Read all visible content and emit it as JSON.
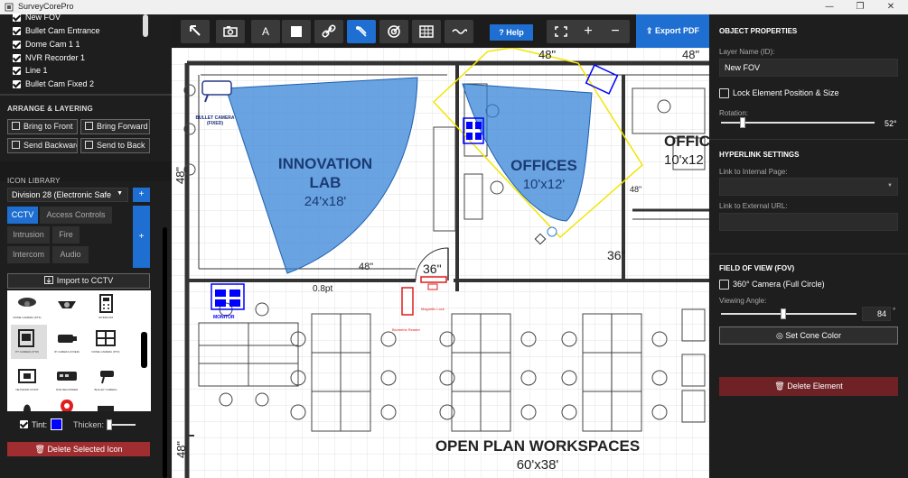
{
  "window": {
    "title": "SurveyCorePro",
    "minimize": "—",
    "maximize": "❐",
    "close": "✕"
  },
  "layers": {
    "items": [
      {
        "label": "New FOV",
        "checked": true
      },
      {
        "label": "Bullet Cam Entrance",
        "checked": true
      },
      {
        "label": "Dome Cam 1 1",
        "checked": true
      },
      {
        "label": "NVR Recorder  1",
        "checked": true
      },
      {
        "label": "Line 1",
        "checked": true
      },
      {
        "label": "Bullet Cam Fixed  2",
        "checked": true
      }
    ]
  },
  "arrange": {
    "title": "ARRANGE & LAYERING",
    "bring_front": "Bring to Front",
    "bring_forward": "Bring Forward",
    "send_backward": "Send Backward",
    "send_back": "Send to Back"
  },
  "icon_library": {
    "title": "ICON LIBRARY",
    "division": "Division 28 (Electronic Safe",
    "add_division": "+",
    "categories": [
      "CCTV",
      "Access Controls",
      "Intrusion",
      "Fire",
      "Intercom",
      "Audio"
    ],
    "active_category": "CCTV",
    "add_category": "+",
    "import_button": "Import to CCTV",
    "icon_names": [
      "DOME CAMERA (PTZ)",
      "",
      "INTERCOM",
      "PT CAMERA (PTZ)",
      "IP CAMERA (FIXED)",
      "DOME CAMERA (PTZ)",
      "NETWORK POINT",
      "NVR RECORDER",
      "BULLET CAMERA"
    ],
    "tint_label": "Tint:",
    "tint_color": "#0000ff",
    "thicken_label": "Thicken:",
    "delete_icon": "Delete Selected Icon"
  },
  "toolbar": {
    "text_tool": "A",
    "help": "Help",
    "export": "Export PDF",
    "zoom_in": "+",
    "zoom_out": "−",
    "active_tool": "camera-fov"
  },
  "floorplan": {
    "dims": [
      "48\"",
      "48\"",
      "48\"",
      "48\"",
      "36\"",
      "36\"",
      "48\"",
      "48\""
    ],
    "rooms": [
      {
        "name": "INNOVATION",
        "name2": "LAB",
        "size": "24'x18'"
      },
      {
        "name": "OFFICES",
        "size": "10'x12'"
      },
      {
        "name": "OFFIC",
        "size": "10'x12"
      },
      {
        "name": "OPEN PLAN WORKSPACES",
        "size": "60'x38'"
      }
    ],
    "line_label": "0.8pt",
    "device_labels": {
      "bullet_camera": "BULLET CAMERA",
      "bullet_camera_sub": "(FIXED)",
      "monitor": "MONITOR",
      "magnetic_lock": "Magnetic Lock",
      "biometric_reader": "Biometric Reader"
    },
    "fov_color": "#2f7fd6",
    "selection_color": "#f2e600"
  },
  "properties": {
    "title": "OBJECT PROPERTIES",
    "layer_name_label": "Layer Name (ID):",
    "layer_name_value": "New FOV",
    "lock_label": "Lock Element Position & Size",
    "lock_checked": false,
    "rotation_label": "Rotation:",
    "rotation_value": "52°",
    "rotation_fraction": 0.14
  },
  "hyperlink": {
    "title": "HYPERLINK SETTINGS",
    "internal_label": "Link to Internal Page:",
    "internal_value": "",
    "external_label": "Link to External URL:",
    "external_value": ""
  },
  "fov": {
    "title": "FIELD OF VIEW (FOV)",
    "full_circle_label": "360° Camera (Full Circle)",
    "full_circle_checked": false,
    "angle_label": "Viewing Angle:",
    "angle_value": "84",
    "angle_unit": "°",
    "angle_fraction": 0.46,
    "cone_color_button": "Set Cone Color",
    "delete_button": "Delete Element"
  },
  "colors": {
    "accent": "#1e6fd1",
    "danger": "#a02e30",
    "panel": "#1e1e1e"
  }
}
